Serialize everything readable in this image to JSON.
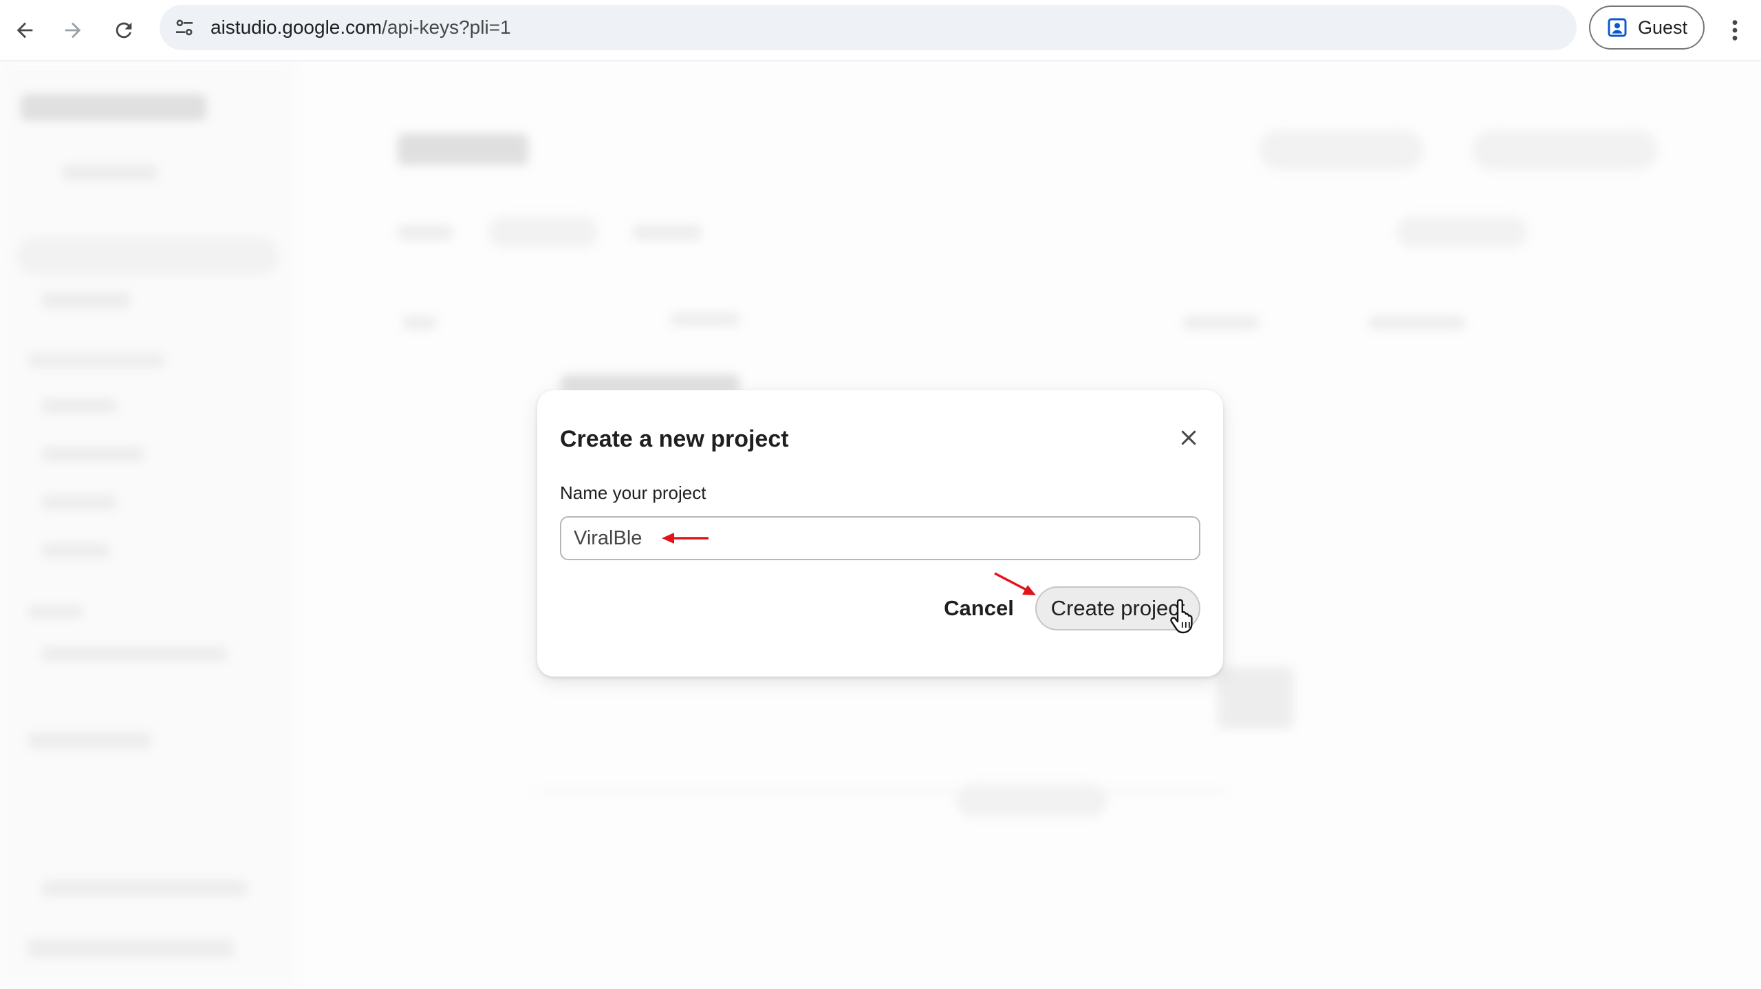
{
  "browser": {
    "back_icon": "arrow-left-icon",
    "forward_icon": "arrow-right-icon",
    "reload_icon": "reload-icon",
    "url_host": "aistudio.google.com",
    "url_path": "/api-keys?pli=1",
    "profile_label": "Guest",
    "menu_icon": "more-vert-icon"
  },
  "dialog": {
    "title": "Create a new project",
    "close_icon": "close-icon",
    "field_label": "Name your project",
    "input_value": "ViralBle",
    "cancel_label": "Cancel",
    "create_label": "Create project"
  },
  "annotations": {
    "arrow_color": "#e0141a"
  }
}
